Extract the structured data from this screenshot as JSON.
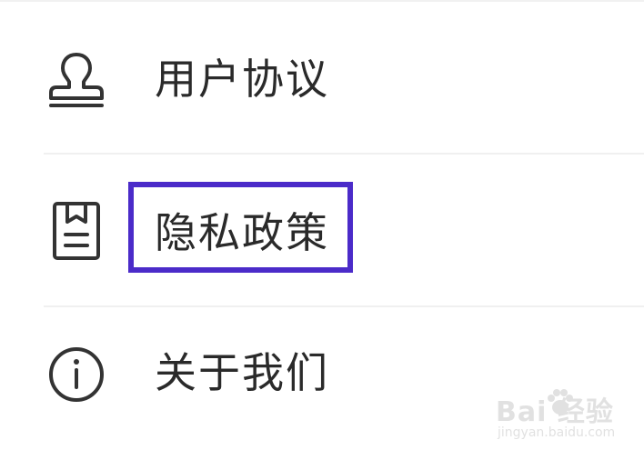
{
  "menu": {
    "items": [
      {
        "label": "用户协议",
        "icon": "user-stamp-icon"
      },
      {
        "label": "隐私政策",
        "icon": "document-icon"
      },
      {
        "label": "关于我们",
        "icon": "info-icon"
      }
    ]
  },
  "highlight": {
    "target": "隐私政策",
    "color": "#4b2bc9"
  },
  "watermark": {
    "logo": "Bai 经验",
    "url": "jingyan.baidu.com"
  }
}
